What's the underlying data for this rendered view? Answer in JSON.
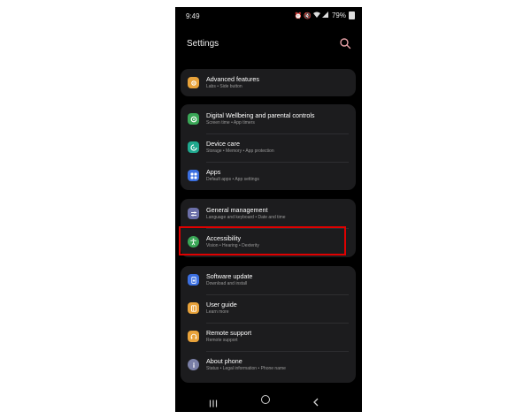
{
  "status": {
    "time": "9:49",
    "battery": "79%"
  },
  "header": {
    "title": "Settings"
  },
  "groups": [
    {
      "items": [
        {
          "title": "Advanced features",
          "subtitle": "Labs  •  Side button",
          "icon": "gear-plus-icon",
          "color": "#e8a23a"
        }
      ]
    },
    {
      "items": [
        {
          "title": "Digital Wellbeing and parental controls",
          "subtitle": "Screen time  •  App timers",
          "icon": "wellbeing-icon",
          "color": "#3aa757"
        },
        {
          "title": "Device care",
          "subtitle": "Storage  •  Memory  •  App protection",
          "icon": "device-care-icon",
          "color": "#1fa88e"
        },
        {
          "title": "Apps",
          "subtitle": "Default apps  •  App settings",
          "icon": "apps-grid-icon",
          "color": "#3b6fe0"
        }
      ]
    },
    {
      "items": [
        {
          "title": "General management",
          "subtitle": "Language and keyboard  •  Date and time",
          "icon": "sliders-icon",
          "color": "#6b6fa8"
        },
        {
          "title": "Accessibility",
          "subtitle": "Vision  •  Hearing  •  Dexterity",
          "icon": "accessibility-icon",
          "color": "#3aa757"
        }
      ]
    },
    {
      "items": [
        {
          "title": "Software update",
          "subtitle": "Download and install",
          "icon": "software-update-icon",
          "color": "#3b6fe0"
        },
        {
          "title": "User guide",
          "subtitle": "Learn more",
          "icon": "user-guide-icon",
          "color": "#e8a23a"
        },
        {
          "title": "Remote support",
          "subtitle": "Remote support",
          "icon": "headset-icon",
          "color": "#e8a23a"
        },
        {
          "title": "About phone",
          "subtitle": "Status  •  Legal information  •  Phone name",
          "icon": "info-icon",
          "color": "#7a7fa6"
        }
      ]
    }
  ],
  "highlight_color": "#e00000"
}
